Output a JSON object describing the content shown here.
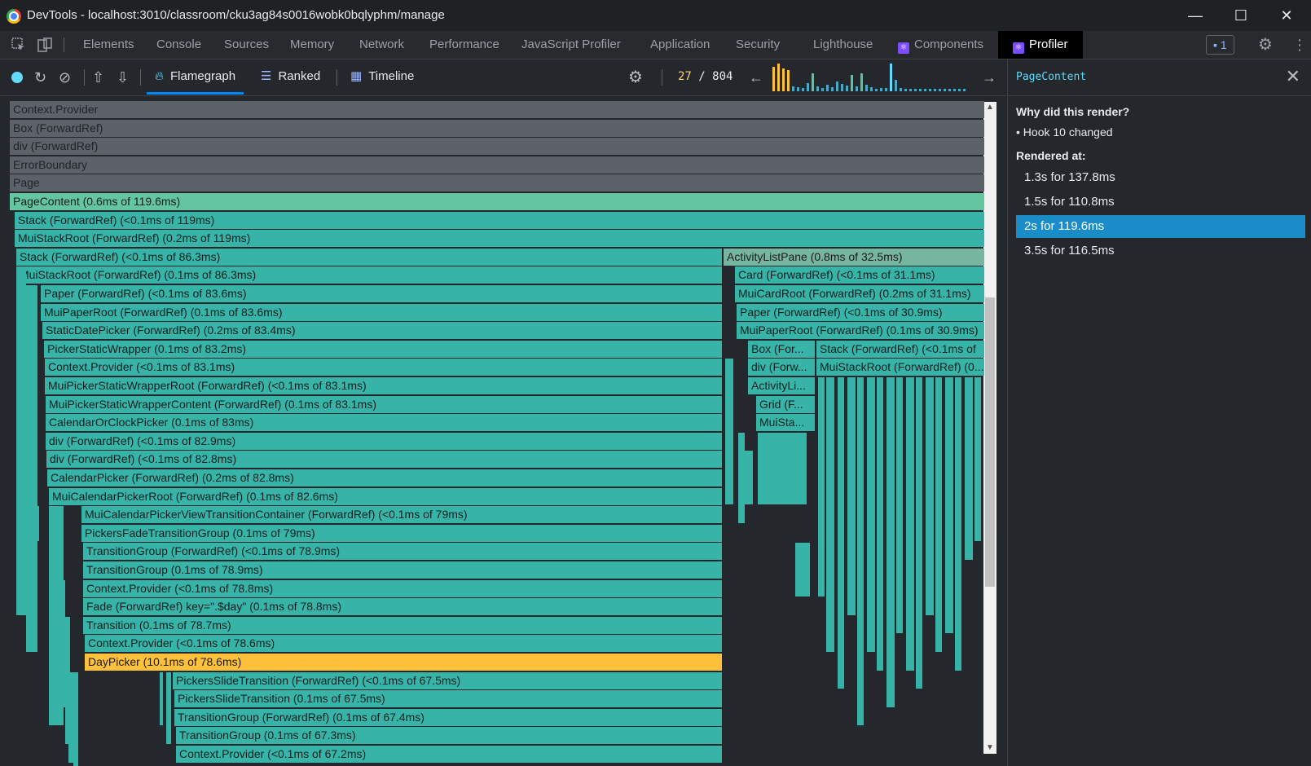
{
  "window": {
    "title": "DevTools - localhost:3010/classroom/cku3ag84s0016wobk0bqlyphm/manage",
    "minimize": "—",
    "maximize": "☐",
    "close": "✕"
  },
  "tabs": [
    "Elements",
    "Console",
    "Sources",
    "Memory",
    "Network",
    "Performance",
    "JavaScript Profiler",
    "Application",
    "Security",
    "Lighthouse",
    "Components",
    "Profiler"
  ],
  "issues_count": "1",
  "toolbar": {
    "views": [
      "Flamegraph",
      "Ranked",
      "Timeline"
    ],
    "commit_current": "27",
    "commit_sep": "/",
    "commit_total": "804",
    "prev": "←",
    "next": "→"
  },
  "flame": {
    "rows": [
      [
        "Context.Provider"
      ],
      [
        "Box (ForwardRef)"
      ],
      [
        "div (ForwardRef)"
      ],
      [
        "ErrorBoundary"
      ],
      [
        "Page"
      ],
      [
        "PageContent (0.6ms of 119.6ms)"
      ],
      [
        "Stack (ForwardRef) (<0.1ms of 119ms)"
      ],
      [
        "MuiStackRoot (ForwardRef) (0.2ms of 119ms)"
      ],
      [
        "Stack (ForwardRef) (<0.1ms of 86.3ms)",
        "ActivityListPane (0.8ms of 32.5ms)"
      ],
      [
        "MuiStackRoot (ForwardRef) (0.1ms of 86.3ms)",
        "Card (ForwardRef) (<0.1ms of 31.1ms)"
      ],
      [
        "Paper (ForwardRef) (<0.1ms of 83.6ms)",
        "MuiCardRoot (ForwardRef) (0.2ms of 31.1ms)"
      ],
      [
        "MuiPaperRoot (ForwardRef) (0.1ms of 83.6ms)",
        "Paper (ForwardRef) (<0.1ms of 30.9ms)"
      ],
      [
        "StaticDatePicker (ForwardRef) (0.2ms of 83.4ms)",
        "MuiPaperRoot (ForwardRef) (0.1ms of 30.9ms)"
      ],
      [
        "PickerStaticWrapper (0.1ms of 83.2ms)",
        "Box (For...",
        "Stack (ForwardRef) (<0.1ms of"
      ],
      [
        "Context.Provider (<0.1ms of 83.1ms)",
        "div (Forw...",
        "MuiStackRoot (ForwardRef) (0..."
      ],
      [
        "MuiPickerStaticWrapperRoot (ForwardRef) (<0.1ms of 83.1ms)",
        "ActivityLi..."
      ],
      [
        "MuiPickerStaticWrapperContent (ForwardRef) (0.1ms of 83.1ms)",
        "Grid (F..."
      ],
      [
        "CalendarOrClockPicker (0.1ms of 83ms)",
        "MuiSta..."
      ],
      [
        "div (ForwardRef) (<0.1ms of 82.9ms)"
      ],
      [
        "div (ForwardRef) (<0.1ms of 82.8ms)"
      ],
      [
        "CalendarPicker (ForwardRef) (0.2ms of 82.8ms)"
      ],
      [
        "MuiCalendarPickerRoot (ForwardRef) (0.1ms of 82.6ms)"
      ],
      [
        "MuiCalendarPickerViewTransitionContainer (ForwardRef) (<0.1ms of 79ms)"
      ],
      [
        "PickersFadeTransitionGroup (0.1ms of 79ms)"
      ],
      [
        "TransitionGroup (ForwardRef) (<0.1ms of 78.9ms)"
      ],
      [
        "TransitionGroup (0.1ms of 78.9ms)"
      ],
      [
        "Context.Provider (<0.1ms of 78.8ms)"
      ],
      [
        "Fade (ForwardRef) key=\".$day\" (0.1ms of 78.8ms)"
      ],
      [
        "Transition (0.1ms of 78.7ms)"
      ],
      [
        "Context.Provider (<0.1ms of 78.6ms)"
      ],
      [
        "DayPicker (10.1ms of 78.6ms)"
      ],
      [
        "PickersSlideTransition (ForwardRef) (<0.1ms of 67.5ms)"
      ],
      [
        "PickersSlideTransition (0.1ms of 67.5ms)"
      ],
      [
        "TransitionGroup (ForwardRef) (0.1ms of 67.4ms)"
      ],
      [
        "TransitionGroup (0.1ms of 67.3ms)"
      ],
      [
        "Context.Provider (<0.1ms of 67.2ms)"
      ]
    ]
  },
  "panel": {
    "component": "PageContent",
    "close": "✕",
    "why_title": "Why did this render?",
    "reason": "• Hook 10 changed",
    "rendered_title": "Rendered at:",
    "renders": [
      "1.3s for 137.8ms",
      "1.5s for 110.8ms",
      "2s for 119.6ms",
      "3.5s for 116.5ms"
    ],
    "selected_index": 2
  },
  "colors": {
    "teal": "#37b3a8",
    "gray": "#5d6269",
    "yellow": "#ffc13b",
    "accent": "#61dafb",
    "selected": "#1a8dc9"
  }
}
